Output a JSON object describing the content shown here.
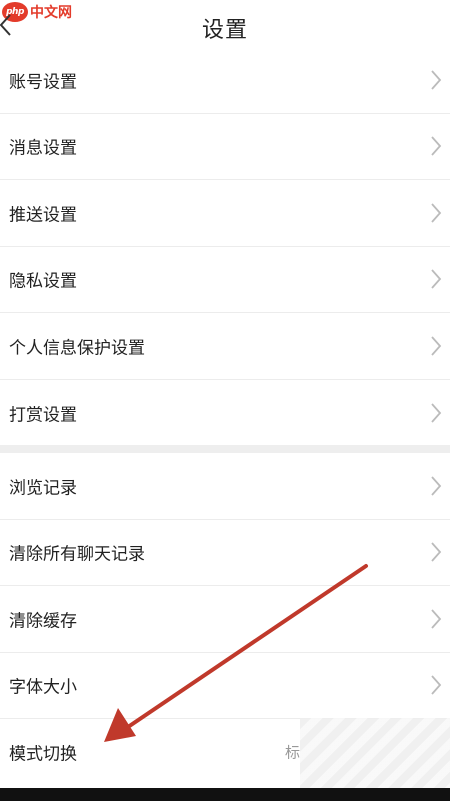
{
  "watermark": {
    "logo": "php",
    "text": "中文网"
  },
  "header": {
    "title": "设置"
  },
  "groups": [
    {
      "items": [
        {
          "label": "账号设置"
        },
        {
          "label": "消息设置"
        },
        {
          "label": "推送设置"
        },
        {
          "label": "隐私设置"
        },
        {
          "label": "个人信息保护设置"
        },
        {
          "label": "打赏设置"
        }
      ]
    },
    {
      "items": [
        {
          "label": "浏览记录"
        },
        {
          "label": "清除所有聊天记录"
        },
        {
          "label": "清除缓存"
        },
        {
          "label": "字体大小"
        },
        {
          "label": "模式切换",
          "value": "标"
        }
      ]
    }
  ],
  "colors": {
    "accent_arrow": "#c0392b",
    "divider": "#ececec",
    "section_gap": "#eeeeee",
    "watermark": "#e33b2a"
  },
  "icons": {
    "back": "chevron-left-icon",
    "row": "chevron-right-icon"
  }
}
